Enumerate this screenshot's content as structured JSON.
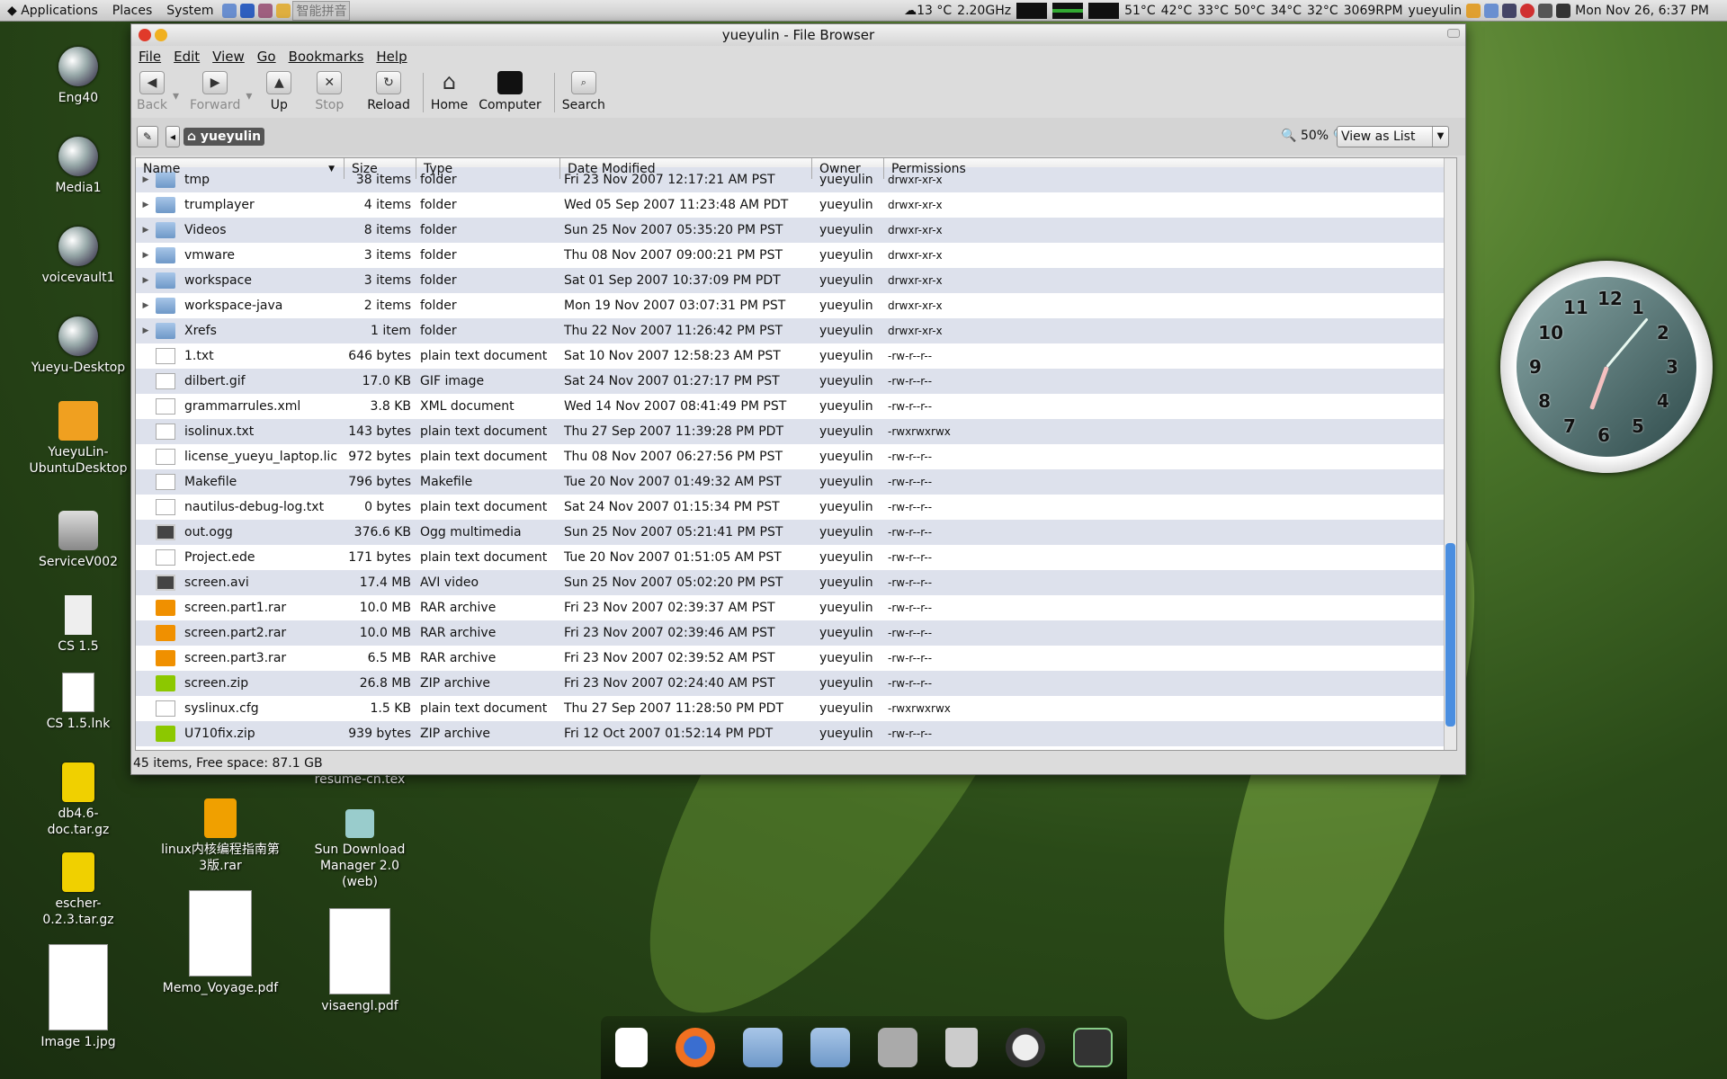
{
  "panel": {
    "menus": [
      "Applications",
      "Places",
      "System"
    ],
    "ime": "智能拼音",
    "weather": "13 °C",
    "cpu": "2.20GHz",
    "temps": [
      "51°C",
      "42°C",
      "33°C",
      "50°C",
      "34°C",
      "32°C"
    ],
    "fan": "3069RPM",
    "user": "yueyulin",
    "datetime": "Mon Nov 26,  6:37 PM"
  },
  "desktop": {
    "icons": [
      {
        "label": "Eng40",
        "kind": "disk"
      },
      {
        "label": "Media1",
        "kind": "disk"
      },
      {
        "label": "voicevault1",
        "kind": "disk"
      },
      {
        "label": "Yueyu-Desktop",
        "kind": "disk"
      },
      {
        "label": "YueyuLin-UbuntuDesktop",
        "kind": "share"
      },
      {
        "label": "ServiceV002",
        "kind": "drive"
      },
      {
        "label": "CS 1.5",
        "kind": "app"
      },
      {
        "label": "CS 1.5.lnk",
        "kind": "doc"
      },
      {
        "label": "db4.6-doc.tar.gz",
        "kind": "arc"
      },
      {
        "label": "escher-0.2.3.tar.gz",
        "kind": "arc"
      },
      {
        "label": "Image 1.jpg",
        "kind": "doc"
      }
    ],
    "icons2": [
      {
        "label": "resume-cn.tex",
        "kind": "none"
      },
      {
        "label": "linux内核编程指南第3版.rar",
        "kind": "rar"
      },
      {
        "label": "Memo_Voyage.pdf",
        "kind": "pdf"
      },
      {
        "label": "Sun Download Manager 2.0 (web)",
        "kind": "dl"
      },
      {
        "label": "visaengl.pdf",
        "kind": "pdf"
      }
    ]
  },
  "window": {
    "title": "yueyulin - File Browser",
    "menu": [
      "File",
      "Edit",
      "View",
      "Go",
      "Bookmarks",
      "Help"
    ],
    "toolbar": [
      {
        "label": "Back",
        "icon": "◀",
        "enabled": false
      },
      {
        "label": "Forward",
        "icon": "▶",
        "enabled": false
      },
      {
        "label": "Up",
        "icon": "▲",
        "enabled": true
      },
      {
        "label": "Stop",
        "icon": "✕",
        "enabled": false
      },
      {
        "label": "Reload",
        "icon": "↻",
        "enabled": true
      },
      {
        "label": "Home",
        "icon": "⌂",
        "enabled": true
      },
      {
        "label": "Computer",
        "icon": "▬",
        "enabled": true
      },
      {
        "label": "Search",
        "icon": "🔍",
        "enabled": true
      }
    ],
    "location": "yueyulin",
    "zoom": "50%",
    "view_mode": "View as List",
    "columns": [
      "Name",
      "Size",
      "Type",
      "Date Modified",
      "Owner",
      "Permissions"
    ],
    "rows": [
      [
        "tmp",
        "38 items",
        "folder",
        "Fri 23 Nov 2007 12:17:21 AM PST",
        "yueyulin",
        "drwxr-xr-x",
        "folder"
      ],
      [
        "trumplayer",
        "4 items",
        "folder",
        "Wed 05 Sep 2007 11:23:48 AM PDT",
        "yueyulin",
        "drwxr-xr-x",
        "folder"
      ],
      [
        "Videos",
        "8 items",
        "folder",
        "Sun 25 Nov 2007 05:35:20 PM PST",
        "yueyulin",
        "drwxr-xr-x",
        "folder"
      ],
      [
        "vmware",
        "3 items",
        "folder",
        "Thu 08 Nov 2007 09:00:21 PM PST",
        "yueyulin",
        "drwxr-xr-x",
        "folder"
      ],
      [
        "workspace",
        "3 items",
        "folder",
        "Sat 01 Sep 2007 10:37:09 PM PDT",
        "yueyulin",
        "drwxr-xr-x",
        "folder"
      ],
      [
        "workspace-java",
        "2 items",
        "folder",
        "Mon 19 Nov 2007 03:07:31 PM PST",
        "yueyulin",
        "drwxr-xr-x",
        "folder"
      ],
      [
        "Xrefs",
        "1 item",
        "folder",
        "Thu 22 Nov 2007 11:26:42 PM PST",
        "yueyulin",
        "drwxr-xr-x",
        "folder"
      ],
      [
        "1.txt",
        "646 bytes",
        "plain text document",
        "Sat 10 Nov 2007 12:58:23 AM PST",
        "yueyulin",
        "-rw-r--r--",
        "file"
      ],
      [
        "dilbert.gif",
        "17.0 KB",
        "GIF image",
        "Sat 24 Nov 2007 01:27:17 PM PST",
        "yueyulin",
        "-rw-r--r--",
        "file"
      ],
      [
        "grammarrules.xml",
        "3.8 KB",
        "XML document",
        "Wed 14 Nov 2007 08:41:49 PM PST",
        "yueyulin",
        "-rw-r--r--",
        "file"
      ],
      [
        "isolinux.txt",
        "143 bytes",
        "plain text document",
        "Thu 27 Sep 2007 11:39:28 PM PDT",
        "yueyulin",
        "-rwxrwxrwx",
        "file"
      ],
      [
        "license_yueyu_laptop.lic",
        "972 bytes",
        "plain text document",
        "Thu 08 Nov 2007 06:27:56 PM PST",
        "yueyulin",
        "-rw-r--r--",
        "file"
      ],
      [
        "Makefile",
        "796 bytes",
        "Makefile",
        "Tue 20 Nov 2007 01:49:32 AM PST",
        "yueyulin",
        "-rw-r--r--",
        "file"
      ],
      [
        "nautilus-debug-log.txt",
        "0 bytes",
        "plain text document",
        "Sat 24 Nov 2007 01:15:34 PM PST",
        "yueyulin",
        "-rw-r--r--",
        "file"
      ],
      [
        "out.ogg",
        "376.6 KB",
        "Ogg multimedia",
        "Sun 25 Nov 2007 05:21:41 PM PST",
        "yueyulin",
        "-rw-r--r--",
        "vid"
      ],
      [
        "Project.ede",
        "171 bytes",
        "plain text document",
        "Tue 20 Nov 2007 01:51:05 AM PST",
        "yueyulin",
        "-rw-r--r--",
        "file"
      ],
      [
        "screen.avi",
        "17.4 MB",
        "AVI video",
        "Sun 25 Nov 2007 05:02:20 PM PST",
        "yueyulin",
        "-rw-r--r--",
        "vid"
      ],
      [
        "screen.part1.rar",
        "10.0 MB",
        "RAR archive",
        "Fri 23 Nov 2007 02:39:37 AM PST",
        "yueyulin",
        "-rw-r--r--",
        "rar"
      ],
      [
        "screen.part2.rar",
        "10.0 MB",
        "RAR archive",
        "Fri 23 Nov 2007 02:39:46 AM PST",
        "yueyulin",
        "-rw-r--r--",
        "rar"
      ],
      [
        "screen.part3.rar",
        "6.5 MB",
        "RAR archive",
        "Fri 23 Nov 2007 02:39:52 AM PST",
        "yueyulin",
        "-rw-r--r--",
        "rar"
      ],
      [
        "screen.zip",
        "26.8 MB",
        "ZIP archive",
        "Fri 23 Nov 2007 02:24:40 AM PST",
        "yueyulin",
        "-rw-r--r--",
        "zip"
      ],
      [
        "syslinux.cfg",
        "1.5 KB",
        "plain text document",
        "Thu 27 Sep 2007 11:28:50 PM PDT",
        "yueyulin",
        "-rwxrwxrwx",
        "file"
      ],
      [
        "U710fix.zip",
        "939 bytes",
        "ZIP archive",
        "Fri 12 Oct 2007 01:52:14 PM PDT",
        "yueyulin",
        "-rw-r--r--",
        "zip"
      ]
    ],
    "status": "45 items, Free space: 87.1 GB"
  },
  "clock": {
    "numbers": [
      "12",
      "1",
      "2",
      "3",
      "4",
      "5",
      "6",
      "7",
      "8",
      "9",
      "10",
      "11"
    ]
  }
}
